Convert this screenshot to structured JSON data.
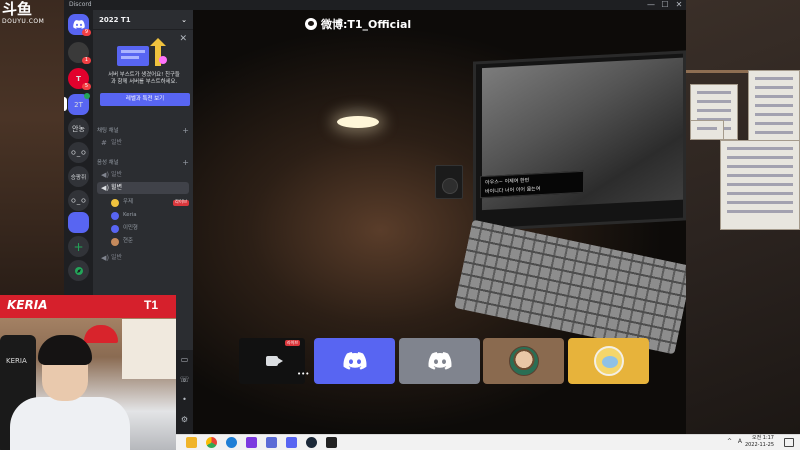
{
  "overlay": {
    "douyu_big": "斗鱼",
    "douyu_small": "DOUYU.COM",
    "watermark": "微博:T1_Official",
    "cam_name": "KERIA",
    "cam_logo": "T1",
    "chair_text": "KERIA"
  },
  "window": {
    "app_name": "Discord",
    "minimize": "—",
    "maximize": "☐",
    "close": "✕"
  },
  "servers": [
    {
      "name": "discord-home",
      "label": "",
      "badge": "9",
      "color": "#5865f2"
    },
    {
      "name": "server-1",
      "label": "",
      "badge": "1",
      "color": "#3a3a3a"
    },
    {
      "name": "server-t1",
      "label": "",
      "badge": "5",
      "color": "#e2012d"
    },
    {
      "name": "server-2t",
      "label": "2T",
      "badge": "",
      "color": "#5865f2"
    },
    {
      "name": "server-annyeong",
      "label": "안농",
      "badge": "",
      "color": "#313338"
    },
    {
      "name": "server-oo1",
      "label": "ㅇ_ㅇ",
      "badge": "",
      "color": "#313338"
    },
    {
      "name": "server-seungwoo",
      "label": "승팡쥐",
      "badge": "",
      "color": "#313338"
    },
    {
      "name": "server-oo2",
      "label": "ㅇ_ㅇ",
      "badge": "",
      "color": "#313338"
    },
    {
      "name": "server-folder",
      "label": "",
      "badge": "",
      "color": "#5865f2"
    },
    {
      "name": "server-blank",
      "label": "",
      "badge": "",
      "color": "#313338"
    },
    {
      "name": "add-server",
      "label": "+",
      "badge": "",
      "color": "#313338"
    },
    {
      "name": "explore-servers",
      "label": "",
      "badge": "",
      "color": "#313338"
    }
  ],
  "sidebar": {
    "server_name": "2022 T1",
    "boost_text_1": "서버 부스트가 생겼어요! 친구들",
    "boost_text_2": "과 함께 서버를 부스트하세요.",
    "boost_button": "레벨과 특전 보기",
    "text_category": "채팅 채널",
    "text_channel": "일반",
    "voice_category": "음성 채널",
    "voice_channels": [
      "일반",
      "힐변",
      "일반"
    ],
    "users": [
      {
        "name": "우제",
        "live": "라이브",
        "color": "#f0c23e"
      },
      {
        "name": "Keria",
        "live": "",
        "color": "#5865f2"
      },
      {
        "name": "이민형",
        "live": "",
        "color": "#5865f2"
      },
      {
        "name": "현준",
        "live": "",
        "color": "#c58a5c"
      }
    ]
  },
  "stage": {
    "subtitle_1": "아우스~ 이제여 한번",
    "subtitle_2": "바이니다 너어 이어 옮는여",
    "stream_badge": "라이브",
    "stream_more": "•••"
  },
  "voice_controls": [
    "screen-share",
    "phone-hangup",
    "settings"
  ],
  "tiles": [
    {
      "name": "tile-discord-1",
      "color": "#5865f2"
    },
    {
      "name": "tile-discord-2",
      "color": "#80848e"
    },
    {
      "name": "tile-avatar-photo",
      "color": "#8a6a4f"
    },
    {
      "name": "tile-avatar-duck",
      "color": "#e7b33b"
    }
  ],
  "taskbar": {
    "time": "오전 1:17",
    "date": "2022-11-25",
    "arrow": "^",
    "kb": "A"
  }
}
